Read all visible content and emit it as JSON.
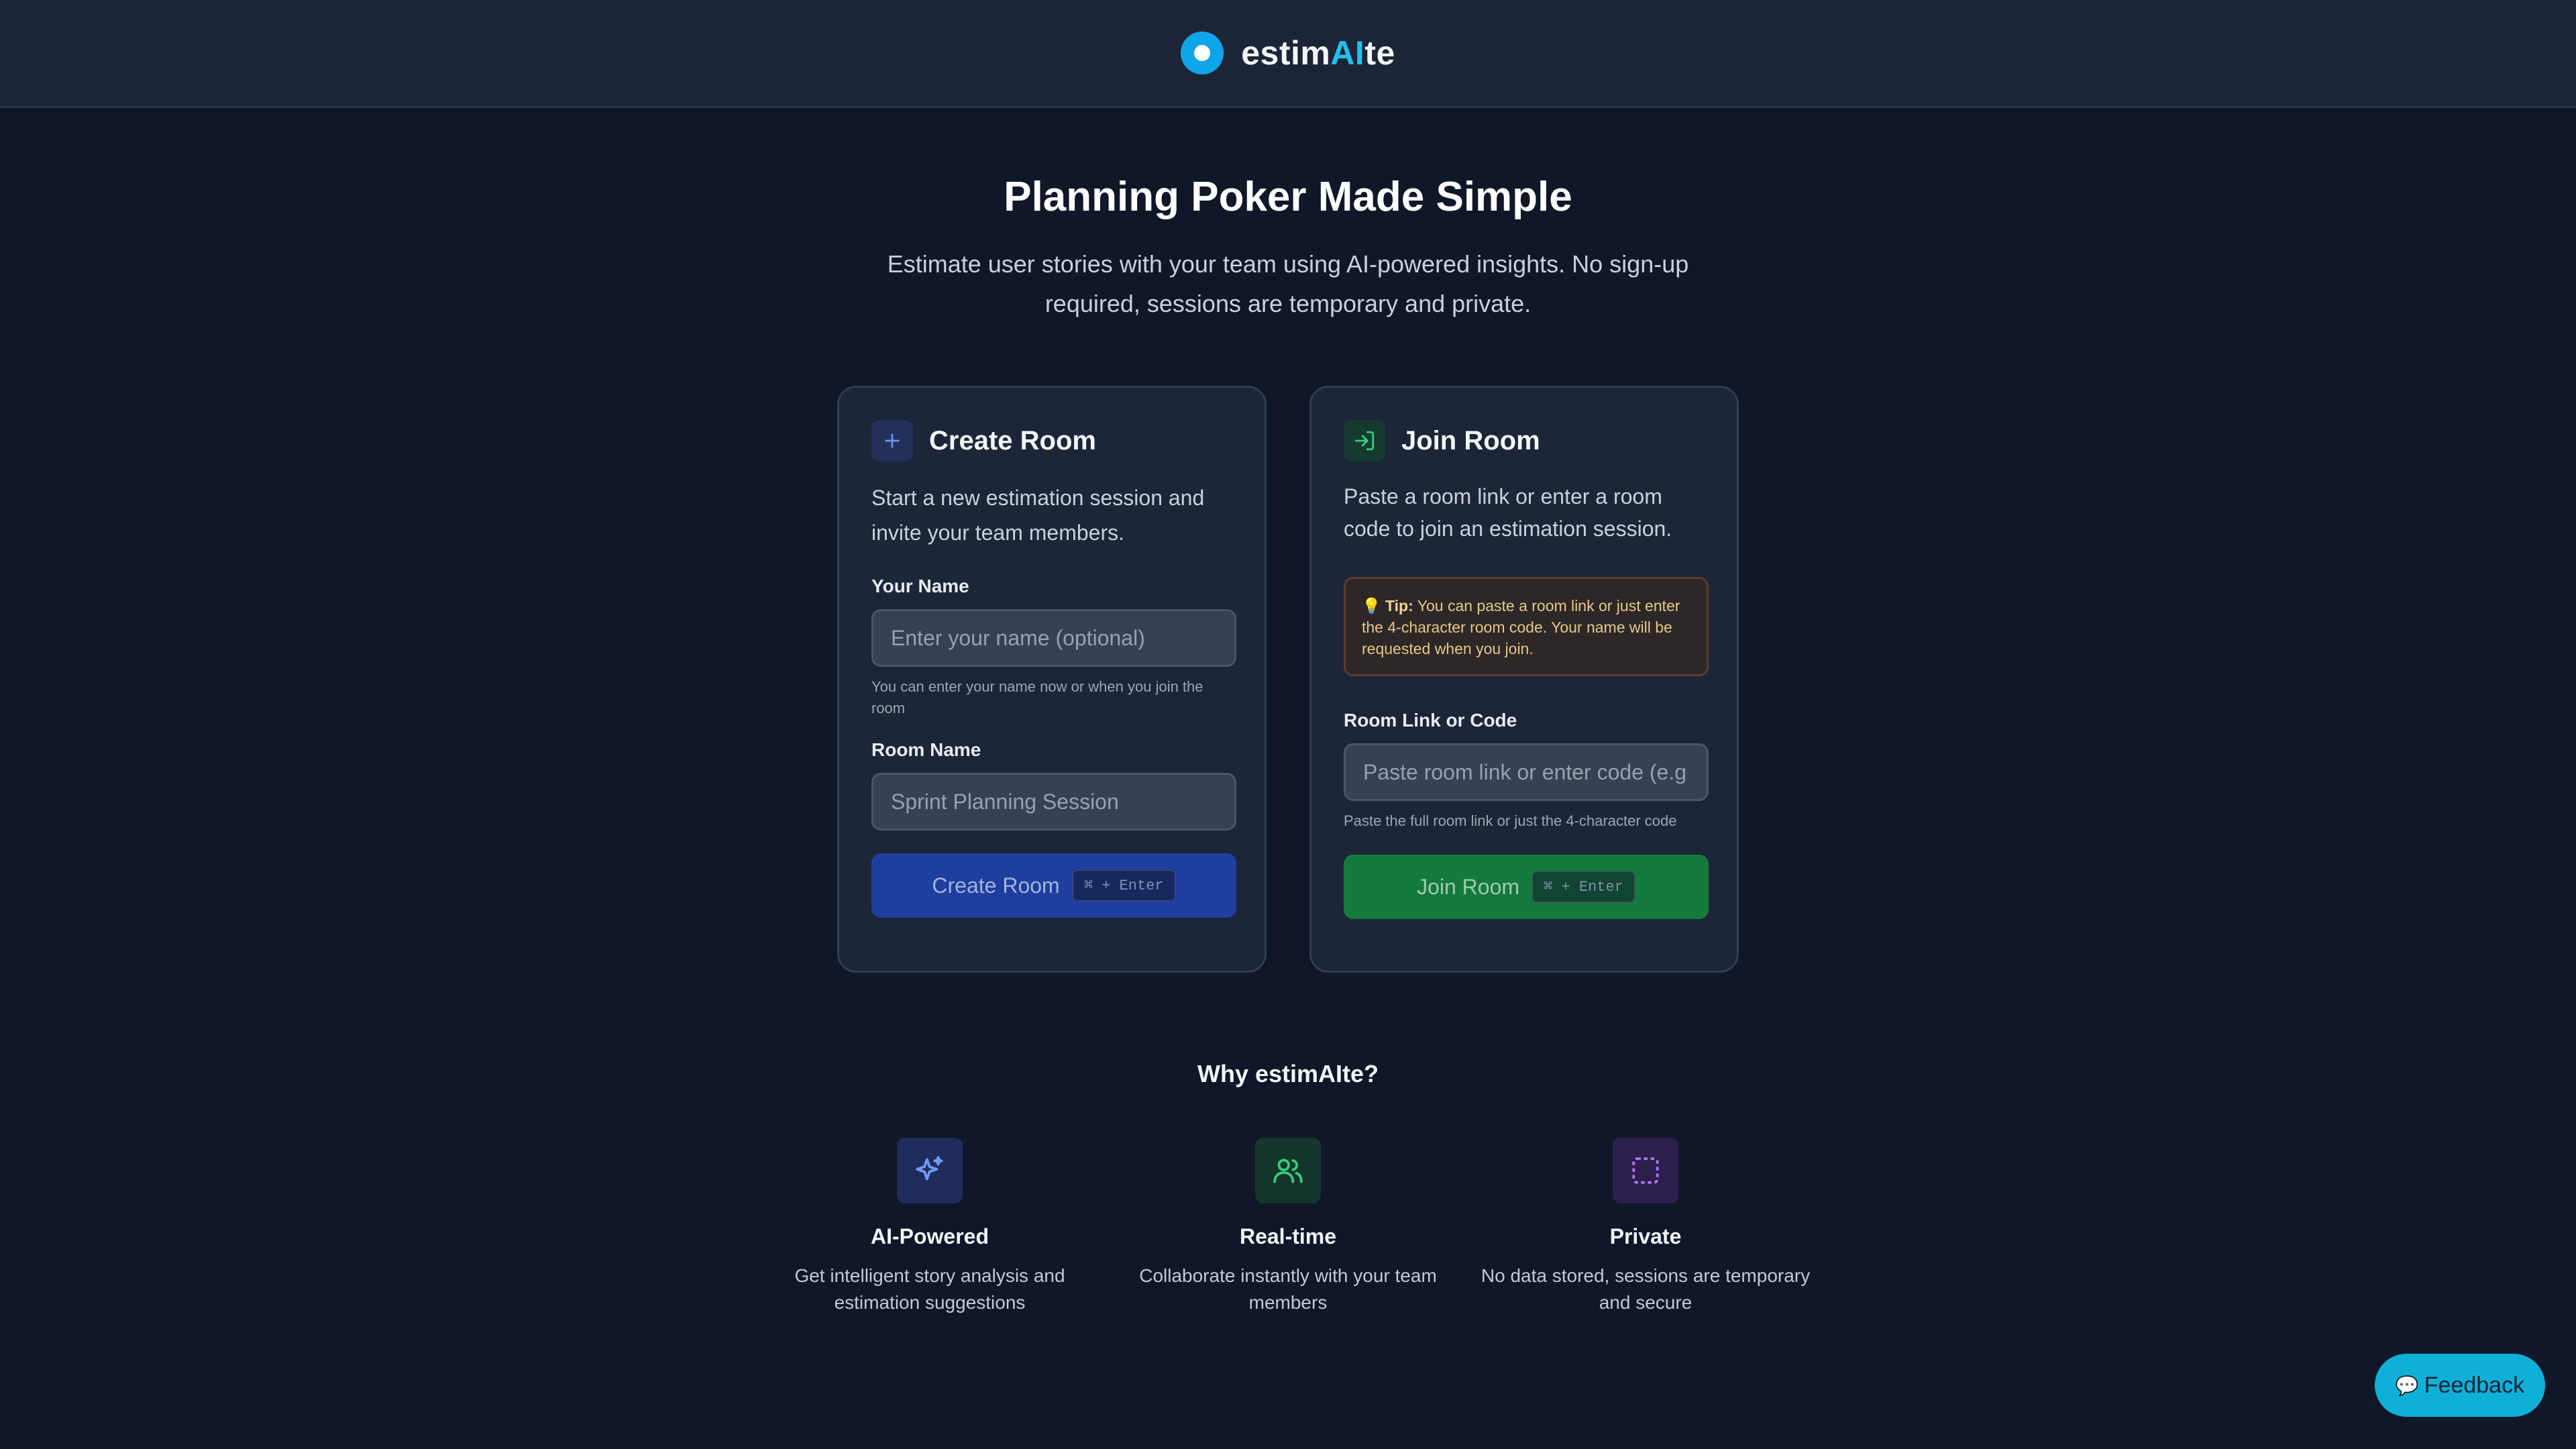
{
  "header": {
    "brand_prefix": "estim",
    "brand_ai": "AI",
    "brand_suffix": "te"
  },
  "hero": {
    "title": "Planning Poker Made Simple",
    "subtitle": "Estimate user stories with your team using AI-powered insights. No sign-up required, sessions are temporary and private."
  },
  "create_room": {
    "icon": "plus-icon",
    "title": "Create Room",
    "description": "Start a new estimation session and invite your team members.",
    "name_label": "Your Name",
    "name_placeholder": "Enter your name (optional)",
    "name_hint": "You can enter your name now or when you join the room",
    "room_label": "Room Name",
    "room_placeholder": "Sprint Planning Session",
    "button_label": "Create Room",
    "button_shortcut": "⌘ + Enter"
  },
  "join_room": {
    "icon": "enter-icon",
    "title": "Join Room",
    "description": "Paste a room link or enter a room code to join an estimation session.",
    "tip_icon": "💡",
    "tip_label": "Tip:",
    "tip_text": "You can paste a room link or just enter the 4-character room code. Your name will be requested when you join.",
    "code_label": "Room Link or Code",
    "code_placeholder": "Paste room link or enter code (e.g",
    "code_hint": "Paste the full room link or just the 4-character code",
    "button_label": "Join Room",
    "button_shortcut": "⌘ + Enter"
  },
  "why": {
    "title": "Why estimAIte?",
    "features": [
      {
        "icon": "sparkles-icon",
        "title": "AI-Powered",
        "description": "Get intelligent story analysis and estimation suggestions"
      },
      {
        "icon": "users-icon",
        "title": "Real-time",
        "description": "Collaborate instantly with your team members"
      },
      {
        "icon": "dashed-square-icon",
        "title": "Private",
        "description": "No data stored, sessions are temporary and secure"
      }
    ]
  },
  "feedback": {
    "icon": "💬",
    "label": "Feedback"
  },
  "colors": {
    "background": "#0f1729",
    "card": "#1c2638",
    "accent": "#22c0f0",
    "create_button": "#1e3fa0",
    "join_button": "#147a3c",
    "feedback_button": "#0fb0d8"
  }
}
